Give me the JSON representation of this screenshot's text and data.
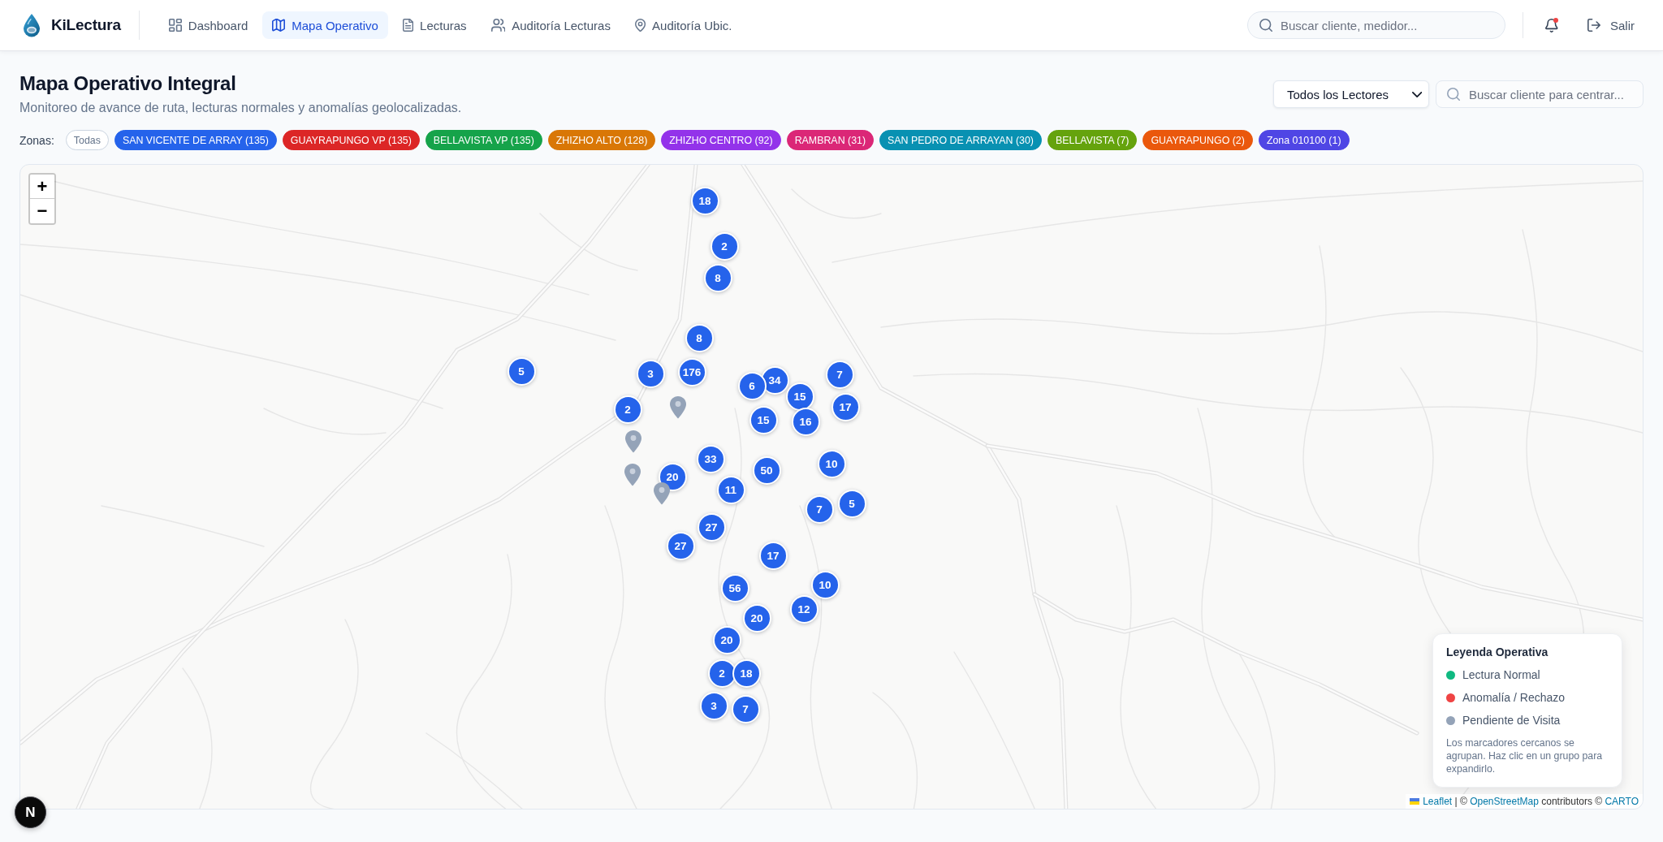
{
  "header": {
    "brand": "KiLectura",
    "nav": [
      {
        "label": "Dashboard",
        "selected": false
      },
      {
        "label": "Mapa Operativo",
        "selected": true
      },
      {
        "label": "Lecturas",
        "selected": false
      },
      {
        "label": "Auditoría Lecturas",
        "selected": false
      },
      {
        "label": "Auditoría Ubic.",
        "selected": false
      }
    ],
    "search": {
      "placeholder": "Buscar cliente, medidor..."
    },
    "notifications": {
      "unread": true
    },
    "logout": {
      "label": "Salir"
    }
  },
  "page": {
    "title": "Mapa Operativo Integral",
    "subtitle": "Monitoreo de avance de ruta, lecturas normales y anomalías geolocalizadas.",
    "reader_select": {
      "value": "Todos los Lectores"
    },
    "map_search": {
      "placeholder": "Buscar cliente para centrar..."
    }
  },
  "zones": {
    "label": "Zonas:",
    "chips": [
      {
        "kind": "all",
        "label": "Todas",
        "selected": false
      },
      {
        "kind": "zone",
        "label": "SAN VICENTE DE ARRAY (135)",
        "color": "#2563eb",
        "selected": false
      },
      {
        "kind": "zone",
        "label": "GUAYRAPUNGO VP (135)",
        "color": "#dc2626",
        "selected": false
      },
      {
        "kind": "zone",
        "label": "BELLAVISTA VP (135)",
        "color": "#16a34a",
        "selected": false
      },
      {
        "kind": "zone",
        "label": "ZHIZHO ALTO (128)",
        "color": "#d97706",
        "selected": false
      },
      {
        "kind": "zone",
        "label": "ZHIZHO CENTRO (92)",
        "color": "#9333ea",
        "selected": false
      },
      {
        "kind": "zone",
        "label": "RAMBRAN (31)",
        "color": "#db2777",
        "selected": false
      },
      {
        "kind": "zone",
        "label": "SAN PEDRO DE ARRAYAN (30)",
        "color": "#0891b2",
        "selected": false
      },
      {
        "kind": "zone",
        "label": "BELLAVISTA (7)",
        "color": "#65a30d",
        "selected": false
      },
      {
        "kind": "zone",
        "label": "GUAYRAPUNGO (2)",
        "color": "#ea580c",
        "selected": false
      },
      {
        "kind": "zone",
        "label": "Zona 010100 (1)",
        "color": "#4f46e5",
        "selected": false
      }
    ]
  },
  "map": {
    "zoom_controls": [
      "+",
      "−"
    ],
    "markers": [
      {
        "kind": "cluster",
        "count": "18"
      },
      {
        "kind": "cluster",
        "count": "2"
      },
      {
        "kind": "cluster",
        "count": "8"
      },
      {
        "kind": "cluster",
        "count": "8"
      },
      {
        "kind": "cluster",
        "count": "5"
      },
      {
        "kind": "cluster",
        "count": "3"
      },
      {
        "kind": "cluster",
        "count": "176"
      },
      {
        "kind": "cluster",
        "count": "34"
      },
      {
        "kind": "cluster",
        "count": "6"
      },
      {
        "kind": "cluster",
        "count": "7"
      },
      {
        "kind": "cluster",
        "count": "15"
      },
      {
        "kind": "cluster",
        "count": "17"
      },
      {
        "kind": "cluster",
        "count": "2"
      },
      {
        "kind": "cluster",
        "count": "15"
      },
      {
        "kind": "cluster",
        "count": "16"
      },
      {
        "kind": "cluster",
        "count": "33"
      },
      {
        "kind": "cluster",
        "count": "50"
      },
      {
        "kind": "cluster",
        "count": "10"
      },
      {
        "kind": "cluster",
        "count": "20"
      },
      {
        "kind": "cluster",
        "count": "11"
      },
      {
        "kind": "cluster",
        "count": "7"
      },
      {
        "kind": "cluster",
        "count": "5"
      },
      {
        "kind": "cluster",
        "count": "27"
      },
      {
        "kind": "cluster",
        "count": "27"
      },
      {
        "kind": "cluster",
        "count": "17"
      },
      {
        "kind": "cluster",
        "count": "56"
      },
      {
        "kind": "cluster",
        "count": "10"
      },
      {
        "kind": "cluster",
        "count": "20"
      },
      {
        "kind": "cluster",
        "count": "12"
      },
      {
        "kind": "cluster",
        "count": "20"
      },
      {
        "kind": "cluster",
        "count": "2"
      },
      {
        "kind": "cluster",
        "count": "18"
      },
      {
        "kind": "cluster",
        "count": "3"
      },
      {
        "kind": "cluster",
        "count": "7"
      },
      {
        "kind": "pin",
        "pending": true
      },
      {
        "kind": "pin",
        "pending": true
      },
      {
        "kind": "pin",
        "pending": true
      },
      {
        "kind": "pin",
        "pending": true
      }
    ],
    "legend": {
      "title": "Leyenda Operativa",
      "items": [
        {
          "label": "Lectura Normal",
          "color": "#10b981"
        },
        {
          "label": "Anomalía / Rechazo",
          "color": "#ef4444"
        },
        {
          "label": "Pendiente de Visita",
          "color": "#94a3b8"
        }
      ],
      "note": "Los marcadores cercanos se agrupan. Haz clic en un grupo para expandirlo."
    },
    "attribution": [
      {
        "kind": "link",
        "text": "Leaflet"
      },
      {
        "kind": "text",
        "text": " | © "
      },
      {
        "kind": "link",
        "text": "OpenStreetMap"
      },
      {
        "kind": "text",
        "text": " contributors © "
      },
      {
        "kind": "link",
        "text": "CARTO"
      }
    ]
  },
  "dev_indicator": {
    "label": "N"
  }
}
